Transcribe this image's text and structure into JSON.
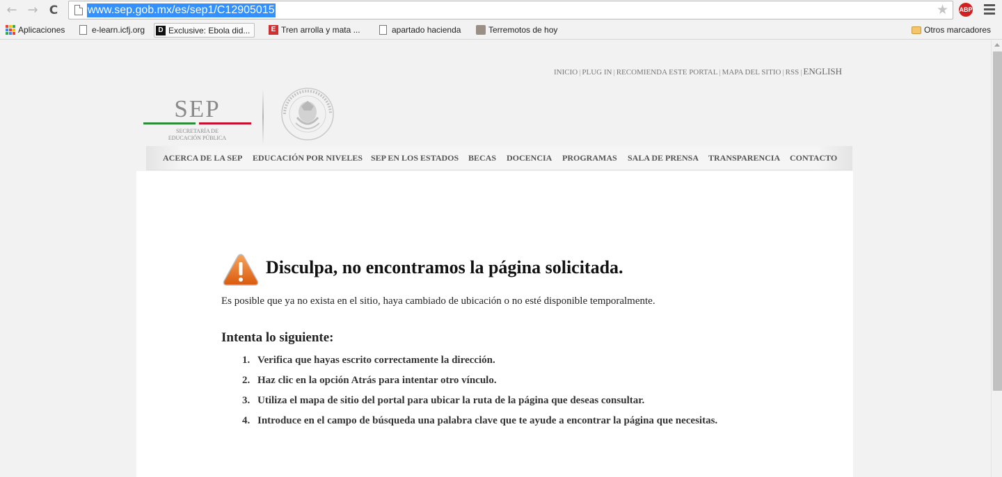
{
  "browser": {
    "url": "www.sep.gob.mx/es/sep1/C12905015",
    "extension_badge": "ABP",
    "bookmarks": [
      {
        "label": "Aplicaciones",
        "icon": "apps-icon"
      },
      {
        "label": "e-learn.icfj.org",
        "icon": "page-icon"
      },
      {
        "label": "Exclusive: Ebola did...",
        "icon": "daily-beast-icon"
      },
      {
        "label": "Tren arrolla y mata ...",
        "icon": "excelsior-icon"
      },
      {
        "label": "apartado hacienda",
        "icon": "page-icon"
      },
      {
        "label": "Terremotos de hoy",
        "icon": "quake-icon"
      }
    ],
    "other_bookmarks": "Otros marcadores"
  },
  "top_links": {
    "inicio": "INICIO",
    "plugin": "PLUG IN",
    "recomienda": "RECOMIENDA ESTE PORTAL",
    "mapa": "MAPA DEL SITIO",
    "rss": "RSS",
    "english": "ENGLISH",
    "separator": "|"
  },
  "logo": {
    "word": "SEP",
    "line1": "SECRETARÍA DE",
    "line2": "EDUCACIÓN PÚBLICA",
    "green": "#2e8b3a",
    "red": "#c8102e"
  },
  "nav": [
    "ACERCA DE LA SEP",
    "EDUCACIÓN POR NIVELES",
    "SEP EN LOS ESTADOS",
    "BECAS",
    "DOCENCIA",
    "PROGRAMAS",
    "SALA DE PRENSA",
    "TRANSPARENCIA",
    "CONTACTO"
  ],
  "error": {
    "title": "Disculpa, no encontramos la página solicitada.",
    "description": "Es posible que ya no exista en el sitio, haya cambiado de ubicación o no esté disponible temporalmente.",
    "try_heading": "Intenta lo siguiente:",
    "steps": [
      {
        "num": "1.",
        "text": "Verifica que hayas escrito correctamente la dirección."
      },
      {
        "num": "2.",
        "text": "Haz clic en la opción Atrás para intentar otro vínculo."
      },
      {
        "num": "3.",
        "text": "Utiliza el mapa de sitio del portal para ubicar la ruta de la página que deseas consultar."
      },
      {
        "num": "4.",
        "text": "Introduce en el campo de búsqueda una palabra clave que te ayude a encontrar la página que necesitas."
      }
    ],
    "warning_color": "#e8701a"
  }
}
